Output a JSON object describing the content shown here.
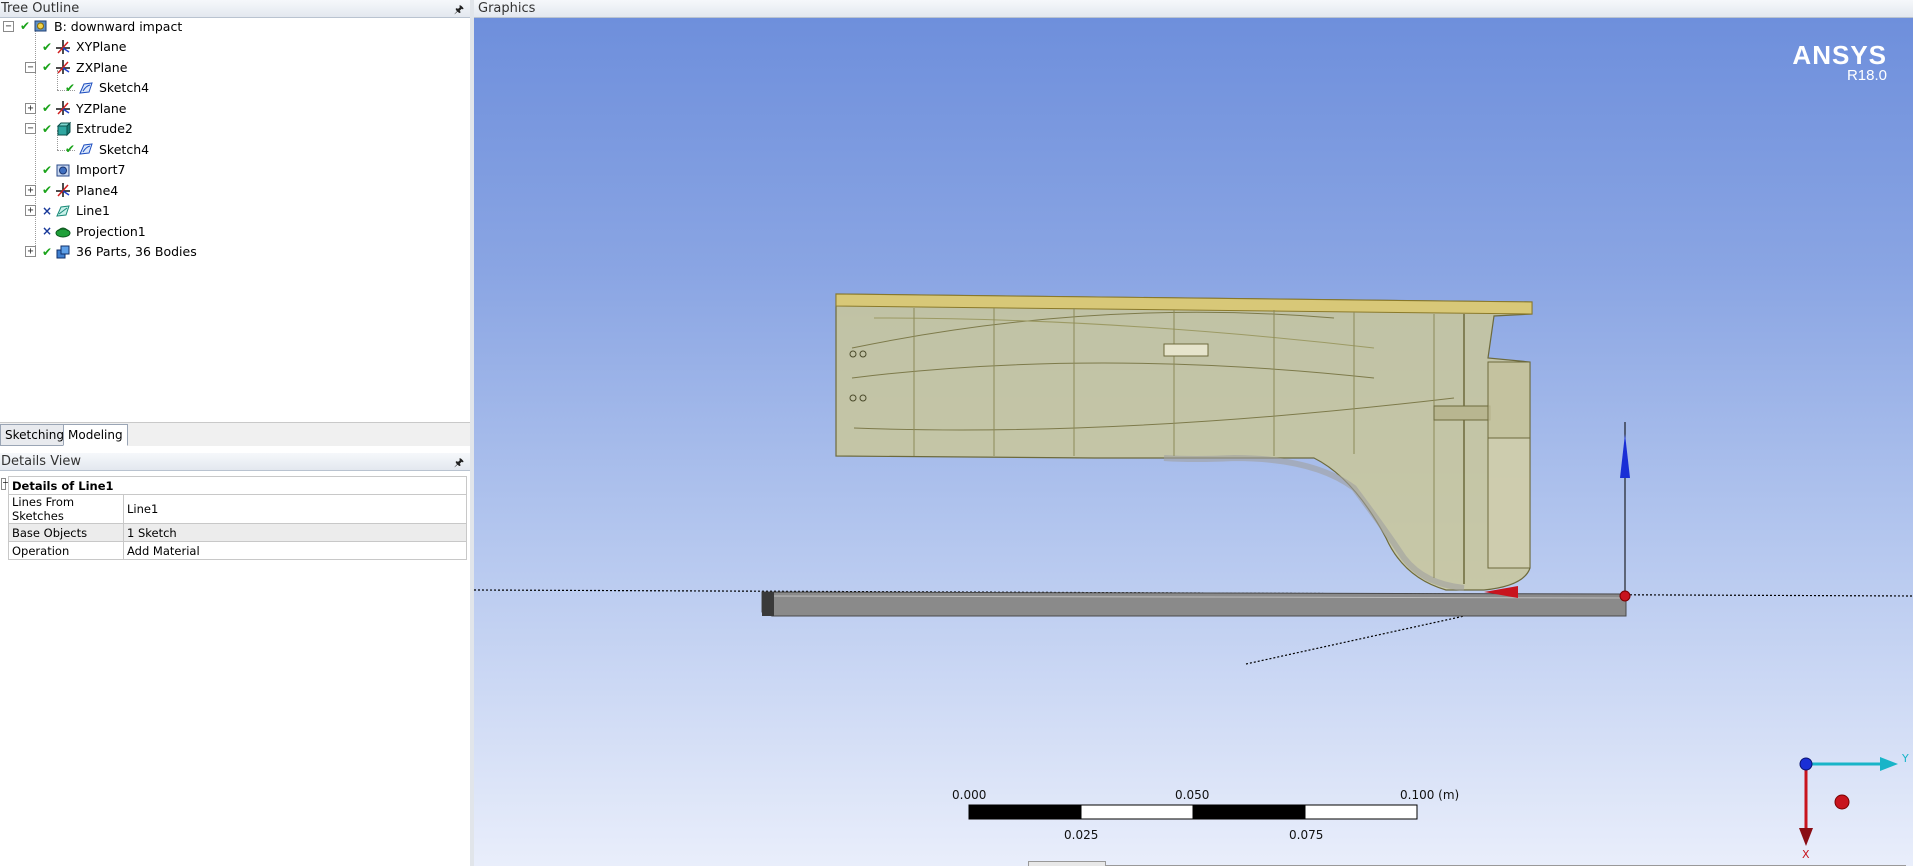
{
  "tree_panel": {
    "title": "Tree Outline",
    "pin_icon": "pin-icon"
  },
  "tree": [
    {
      "label": "B: downward impact",
      "icon": "geometry-root-icon",
      "status": "ok",
      "expander": "−",
      "level": 0
    },
    {
      "label": "XYPlane",
      "icon": "plane-icon",
      "status": "ok",
      "expander": "",
      "level": 1
    },
    {
      "label": "ZXPlane",
      "icon": "plane-icon",
      "status": "ok",
      "expander": "−",
      "level": 1
    },
    {
      "label": "Sketch4",
      "icon": "sketch-icon",
      "status": "ok",
      "expander": "",
      "level": 2
    },
    {
      "label": "YZPlane",
      "icon": "plane-icon",
      "status": "ok",
      "expander": "+",
      "level": 1
    },
    {
      "label": "Extrude2",
      "icon": "extrude-icon",
      "status": "ok",
      "expander": "−",
      "level": 1
    },
    {
      "label": "Sketch4",
      "icon": "sketch-icon",
      "status": "ok",
      "expander": "",
      "level": 2
    },
    {
      "label": "Import7",
      "icon": "import-icon",
      "status": "ok",
      "expander": "",
      "level": 1
    },
    {
      "label": "Plane4",
      "icon": "plane-icon",
      "status": "ok",
      "expander": "+",
      "level": 1
    },
    {
      "label": "Line1",
      "icon": "line-body-icon",
      "status": "x",
      "expander": "+",
      "level": 1
    },
    {
      "label": "Projection1",
      "icon": "projection-icon",
      "status": "x",
      "expander": "",
      "level": 1
    },
    {
      "label": "36 Parts, 36 Bodies",
      "icon": "parts-icon",
      "status": "ok",
      "expander": "+",
      "level": 1
    }
  ],
  "tabs": [
    {
      "label": "Sketching",
      "active": false
    },
    {
      "label": "Modeling",
      "active": true
    }
  ],
  "details_panel": {
    "title": "Details View",
    "header": "Details of Line1",
    "rows": [
      {
        "key": "Lines From Sketches",
        "value": "Line1"
      },
      {
        "key": "Base Objects",
        "value": "1 Sketch"
      },
      {
        "key": "Operation",
        "value": "Add Material"
      }
    ]
  },
  "graphics": {
    "title": "Graphics",
    "brand": "ANSYS",
    "version": "R18.0",
    "scale_bar": {
      "top_labels": [
        "0.000",
        "0.050",
        "0.100 (m)"
      ],
      "bottom_labels": [
        "0.025",
        "0.075"
      ]
    },
    "triad": {
      "y_label": "Y",
      "x_label": "X"
    },
    "colors": {
      "part": "#c9c79a",
      "part_edge": "#7d7a4a",
      "plate": "#8a8a8a",
      "axis_blue": "#1a2fd6",
      "axis_red": "#c8141e",
      "triad_cyan": "#18b4c8"
    }
  }
}
